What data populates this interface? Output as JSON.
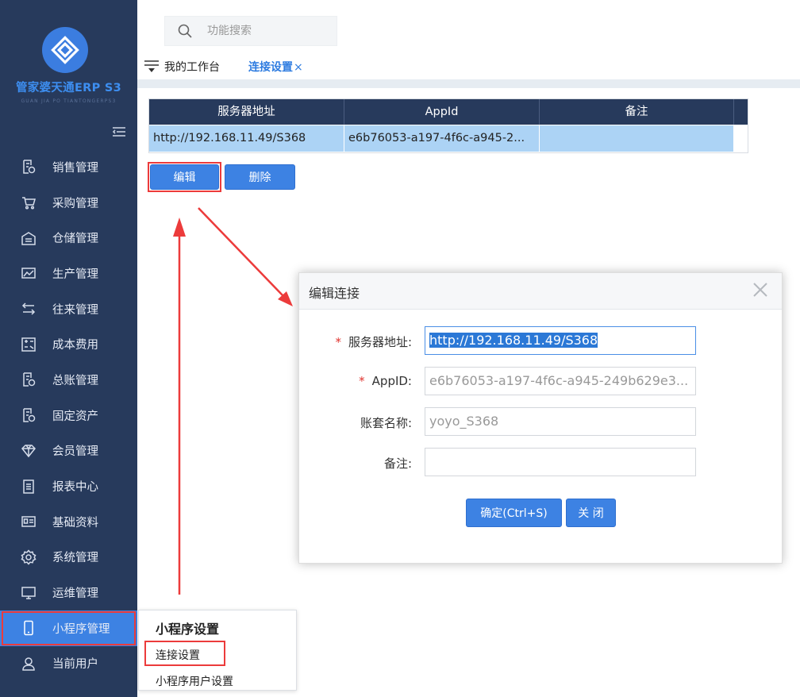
{
  "sidebar": {
    "brand": "管家婆天通ERP S3",
    "brand_sub": "GUAN JIA PO TIANTONGERPS3",
    "items": [
      {
        "label": "销售管理",
        "icon": "sales-doc-icon"
      },
      {
        "label": "采购管理",
        "icon": "cart-icon"
      },
      {
        "label": "仓储管理",
        "icon": "warehouse-icon"
      },
      {
        "label": "生产管理",
        "icon": "factory-icon"
      },
      {
        "label": "往来管理",
        "icon": "exchange-icon"
      },
      {
        "label": "成本费用",
        "icon": "calculator-icon"
      },
      {
        "label": "总账管理",
        "icon": "ledger-icon"
      },
      {
        "label": "固定资产",
        "icon": "asset-icon"
      },
      {
        "label": "会员管理",
        "icon": "diamond-icon"
      },
      {
        "label": "报表中心",
        "icon": "report-icon"
      },
      {
        "label": "基础资料",
        "icon": "id-card-icon"
      },
      {
        "label": "系统管理",
        "icon": "gear-icon"
      },
      {
        "label": "运维管理",
        "icon": "monitor-icon"
      },
      {
        "label": "小程序管理",
        "icon": "phone-icon",
        "active": true
      },
      {
        "label": "当前用户",
        "icon": "user-icon"
      }
    ]
  },
  "search": {
    "placeholder": "功能搜索"
  },
  "tabs": [
    {
      "label": "我的工作台"
    },
    {
      "label": "连接设置",
      "close": "×",
      "active": true
    }
  ],
  "table": {
    "columns": [
      "服务器地址",
      "AppId",
      "备注"
    ],
    "rows": [
      [
        "http://192.168.11.49/S368",
        "e6b76053-a197-4f6c-a945-2...",
        ""
      ]
    ]
  },
  "actions": {
    "edit": "编辑",
    "delete": "删除"
  },
  "dialog": {
    "title": "编辑连接",
    "fields": [
      {
        "label": "服务器地址:",
        "required": "*",
        "value": "http://192.168.11.49/S368"
      },
      {
        "label": "AppID:",
        "required": "*",
        "value": "e6b76053-a197-4f6c-a945-249b629e3..."
      },
      {
        "label": "账套名称:",
        "value": "yoyo_S368"
      },
      {
        "label": "备注:",
        "value": ""
      }
    ],
    "ok": "确定(Ctrl+S)",
    "close": "关 闭"
  },
  "flyout": {
    "title": "小程序设置",
    "items": [
      "连接设置",
      "小程序用户设置"
    ]
  },
  "colors": {
    "sidebar": "#273a5c",
    "accent": "#3d82e3",
    "highlight": "#ec3b3b",
    "selected_row": "#acd3f5"
  }
}
